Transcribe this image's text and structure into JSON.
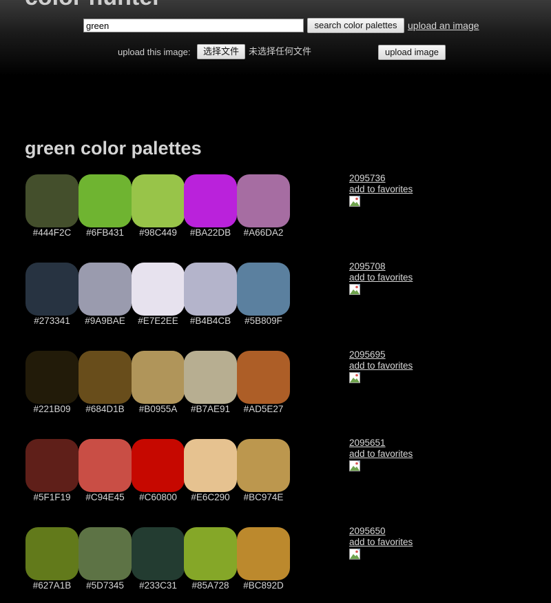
{
  "header": {
    "site_title": "color hunter",
    "search_value": "green",
    "search_button_label": "search color palettes",
    "upload_link_label": "upload an image",
    "upload_label": "upload this image:",
    "choose_file_label": "选择文件",
    "no_file_label": "未选择任何文件",
    "upload_button_label": "upload image"
  },
  "results": {
    "heading": "green color palettes",
    "favorite_label": "add to favorites",
    "palettes": [
      {
        "id": "2095736",
        "colors": [
          "#444F2C",
          "#6FB431",
          "#98C449",
          "#BA22DB",
          "#A66DA2"
        ]
      },
      {
        "id": "2095708",
        "colors": [
          "#273341",
          "#9A9BAE",
          "#E7E2EE",
          "#B4B4CB",
          "#5B809F"
        ]
      },
      {
        "id": "2095695",
        "colors": [
          "#221B09",
          "#684D1B",
          "#B0955A",
          "#B7AE91",
          "#AD5E27"
        ]
      },
      {
        "id": "2095651",
        "colors": [
          "#5F1F19",
          "#C94E45",
          "#C60800",
          "#E6C290",
          "#BC974E"
        ]
      },
      {
        "id": "2095650",
        "colors": [
          "#627A1B",
          "#5D7345",
          "#233C31",
          "#85A728",
          "#BC892D"
        ]
      }
    ]
  }
}
